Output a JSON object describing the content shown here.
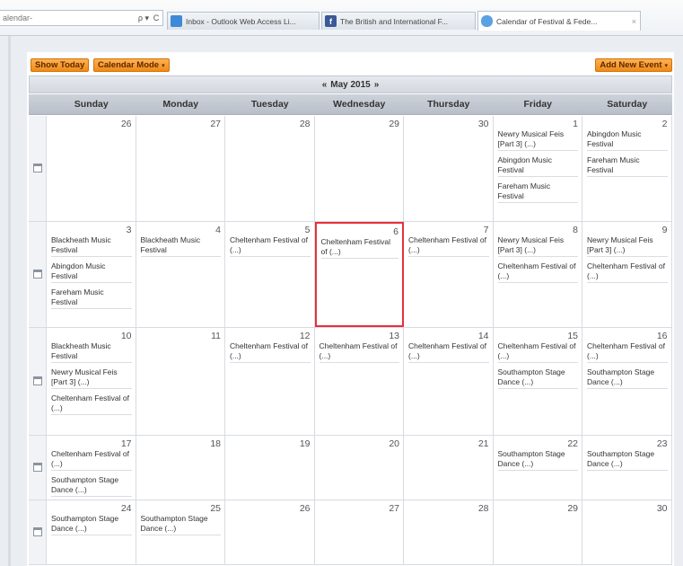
{
  "browser": {
    "address_text": "alendar-",
    "addr_icons": [
      "ρ ▾",
      "C"
    ],
    "tabs": [
      {
        "label": "Inbox - Outlook Web Access Li..."
      },
      {
        "label": "The British and International F..."
      },
      {
        "label": "Calendar of Festival & Fede...",
        "close": "×"
      }
    ]
  },
  "toolbar": {
    "show_today": "Show Today",
    "calendar_mode": "Calendar Mode",
    "add_new_event": "Add New Event",
    "caret": "▾"
  },
  "month": {
    "prev": "«",
    "title": "May 2015",
    "next": "»"
  },
  "day_headers": [
    "Sunday",
    "Monday",
    "Tuesday",
    "Wednesday",
    "Thursday",
    "Friday",
    "Saturday"
  ],
  "weeks": [
    {
      "days": [
        {
          "num": "26",
          "events": []
        },
        {
          "num": "27",
          "events": []
        },
        {
          "num": "28",
          "events": []
        },
        {
          "num": "29",
          "events": []
        },
        {
          "num": "30",
          "events": []
        },
        {
          "num": "1",
          "events": [
            "Newry Musical Feis [Part 3] (...)",
            "Abingdon Music Festival",
            "Fareham Music Festival"
          ]
        },
        {
          "num": "2",
          "events": [
            "Abingdon Music Festival",
            "Fareham Music Festival"
          ]
        }
      ]
    },
    {
      "days": [
        {
          "num": "3",
          "events": [
            "Blackheath Music Festival",
            "Abingdon Music Festival",
            "Fareham Music Festival"
          ]
        },
        {
          "num": "4",
          "events": [
            "Blackheath Music Festival"
          ]
        },
        {
          "num": "5",
          "events": [
            "Cheltenham Festival of (...)"
          ]
        },
        {
          "num": "6",
          "events": [
            "Cheltenham Festival of (...)"
          ],
          "today": true
        },
        {
          "num": "7",
          "events": [
            "Cheltenham Festival of (...)"
          ]
        },
        {
          "num": "8",
          "events": [
            "Newry Musical Feis [Part 3] (...)",
            "Cheltenham Festival of (...)"
          ]
        },
        {
          "num": "9",
          "events": [
            "Newry Musical Feis [Part 3] (...)",
            "Cheltenham Festival of (...)"
          ]
        }
      ]
    },
    {
      "days": [
        {
          "num": "10",
          "events": [
            "Blackheath Music Festival",
            "Newry Musical Feis [Part 3] (...)",
            "Cheltenham Festival of (...)"
          ]
        },
        {
          "num": "11",
          "events": []
        },
        {
          "num": "12",
          "events": [
            "Cheltenham Festival of (...)"
          ]
        },
        {
          "num": "13",
          "events": [
            "Cheltenham Festival of (...)"
          ]
        },
        {
          "num": "14",
          "events": [
            "Cheltenham Festival of (...)"
          ]
        },
        {
          "num": "15",
          "events": [
            "Cheltenham Festival of (...)",
            "Southampton Stage Dance (...)"
          ]
        },
        {
          "num": "16",
          "events": [
            "Cheltenham Festival of (...)",
            "Southampton Stage Dance (...)"
          ]
        }
      ]
    },
    {
      "days": [
        {
          "num": "17",
          "events": [
            "Cheltenham Festival of (...)",
            "Southampton Stage Dance (...)"
          ]
        },
        {
          "num": "18",
          "events": []
        },
        {
          "num": "19",
          "events": []
        },
        {
          "num": "20",
          "events": []
        },
        {
          "num": "21",
          "events": []
        },
        {
          "num": "22",
          "events": [
            "Southampton Stage Dance (...)"
          ]
        },
        {
          "num": "23",
          "events": [
            "Southampton Stage Dance (...)"
          ]
        }
      ]
    },
    {
      "days": [
        {
          "num": "24",
          "events": [
            "Southampton Stage Dance (...)"
          ]
        },
        {
          "num": "25",
          "events": [
            "Southampton Stage Dance (...)"
          ]
        },
        {
          "num": "26",
          "events": []
        },
        {
          "num": "27",
          "events": []
        },
        {
          "num": "28",
          "events": []
        },
        {
          "num": "29",
          "events": []
        },
        {
          "num": "30",
          "events": []
        }
      ]
    }
  ],
  "colors": {
    "button": "#f08a16",
    "today_border": "#e8303c",
    "header_bg": "#c3c9d2"
  }
}
